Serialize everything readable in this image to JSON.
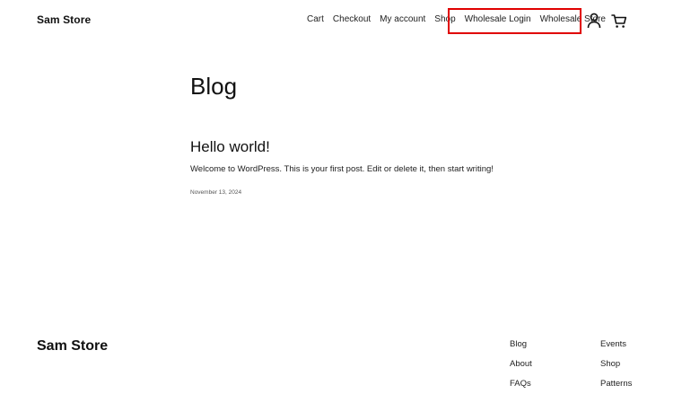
{
  "header": {
    "site_title": "Sam Store",
    "nav": [
      {
        "label": "Cart"
      },
      {
        "label": "Checkout"
      },
      {
        "label": "My account"
      },
      {
        "label": "Shop"
      },
      {
        "label": "Wholesale Login"
      },
      {
        "label": "Wholesale Store"
      }
    ],
    "highlight_color": "#e00000"
  },
  "main": {
    "page_title": "Blog",
    "post": {
      "title": "Hello world!",
      "excerpt": "Welcome to WordPress. This is your first post. Edit or delete it, then start writing!",
      "date": "November 13, 2024"
    }
  },
  "footer": {
    "site_title": "Sam Store",
    "col1": [
      {
        "label": "Blog"
      },
      {
        "label": "About"
      },
      {
        "label": "FAQs"
      }
    ],
    "col2": [
      {
        "label": "Events"
      },
      {
        "label": "Shop"
      },
      {
        "label": "Patterns"
      }
    ]
  },
  "icons": {
    "account": "user-icon",
    "cart": "cart-icon"
  }
}
